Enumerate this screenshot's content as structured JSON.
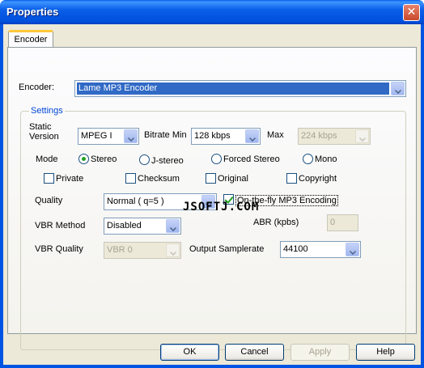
{
  "window": {
    "title": "Properties"
  },
  "tabs": [
    {
      "label": "Encoder"
    }
  ],
  "encoder": {
    "label": "Encoder:",
    "value": "Lame MP3 Encoder"
  },
  "settings": {
    "group_title": "Settings",
    "static_version_label_line1": "Static",
    "static_version_label_line2": "Version",
    "version_value": "MPEG I",
    "bitrate_min_label": "Bitrate Min",
    "bitrate_min_value": "128 kbps",
    "max_label": "Max",
    "max_value": "224 kbps",
    "mode_label": "Mode",
    "modes": [
      {
        "label": "Stereo",
        "selected": true
      },
      {
        "label": "J-stereo",
        "selected": false
      },
      {
        "label": "Forced Stereo",
        "selected": false
      },
      {
        "label": "Mono",
        "selected": false
      }
    ],
    "flags": [
      {
        "label": "Private",
        "checked": false
      },
      {
        "label": "Checksum",
        "checked": false
      },
      {
        "label": "Original",
        "checked": false
      },
      {
        "label": "Copyright",
        "checked": false
      }
    ],
    "quality_label": "Quality",
    "quality_value": "Normal ( q=5 )",
    "onthefly_label": "On-the-fly MP3 Encoding",
    "onthefly_checked": true,
    "vbr_method_label": "VBR Method",
    "vbr_method_value": "Disabled",
    "abr_label": "ABR (kpbs)",
    "abr_value": "0",
    "vbr_quality_label": "VBR Quality",
    "vbr_quality_value": "VBR 0",
    "output_samplerate_label": "Output Samplerate",
    "output_samplerate_value": "44100"
  },
  "watermark": "JSOFTJ.COM",
  "buttons": {
    "ok": "OK",
    "cancel": "Cancel",
    "apply": "Apply",
    "help": "Help"
  }
}
